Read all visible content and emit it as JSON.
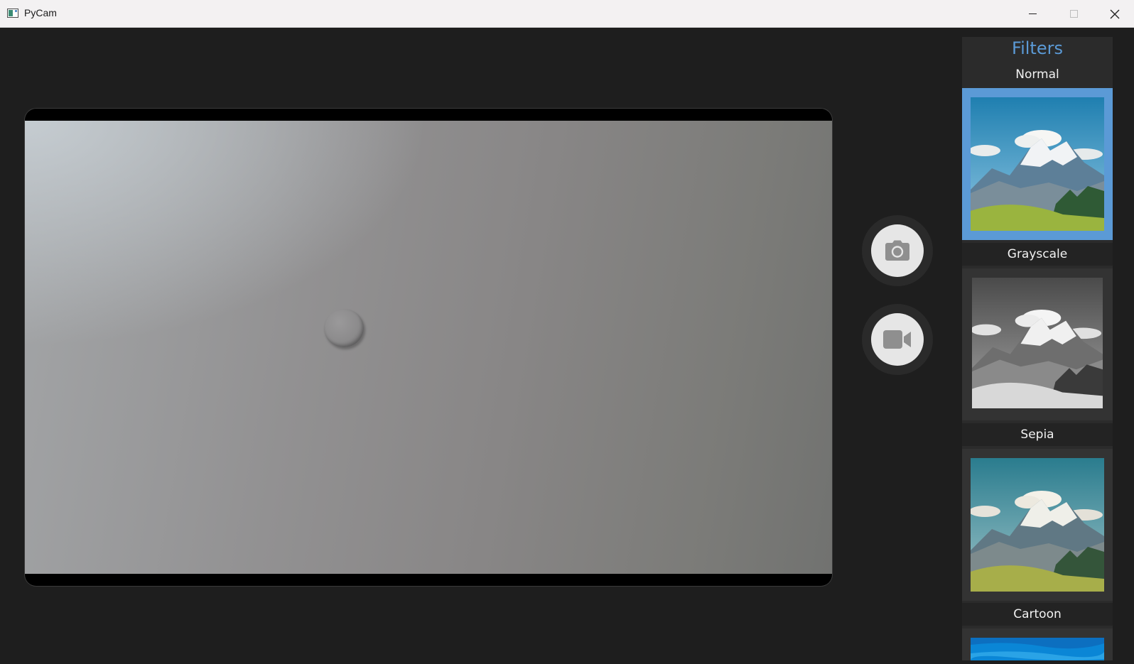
{
  "window": {
    "title": "PyCam",
    "controls": [
      "minimize",
      "maximize",
      "close"
    ]
  },
  "preview": {
    "source": "camera-feed"
  },
  "controls": {
    "photo_icon": "camera-icon",
    "video_icon": "video-camera-icon"
  },
  "filters": {
    "title": "Filters",
    "selected": "Normal",
    "items": [
      {
        "label": "Normal"
      },
      {
        "label": "Grayscale"
      },
      {
        "label": "Sepia"
      },
      {
        "label": "Cartoon"
      }
    ]
  },
  "colors": {
    "accent": "#5b9ad6",
    "background": "#1e1e1e",
    "panel": "#2b2b2b",
    "titlebar": "#f3f1f2"
  }
}
